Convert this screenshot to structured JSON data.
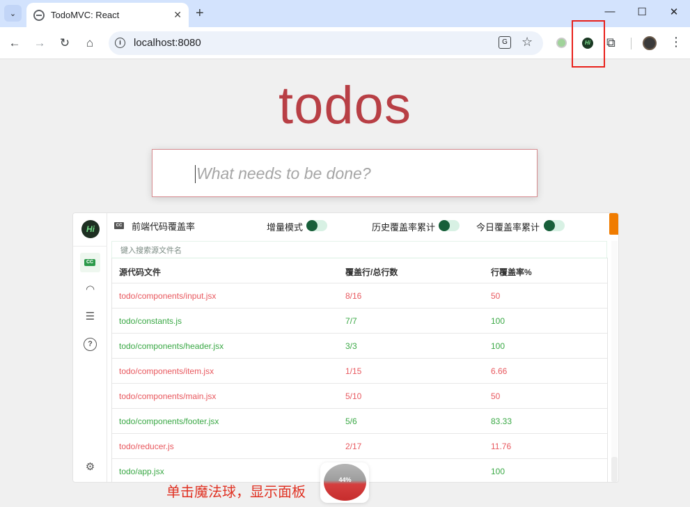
{
  "browser": {
    "tab_title": "TodoMVC: React",
    "url": "localhost:8080",
    "tab_close": "✕",
    "new_tab": "+",
    "minimize": "—",
    "maximize": "☐",
    "close": "✕"
  },
  "app": {
    "title": "todos",
    "input_placeholder": "What needs to be done?"
  },
  "panel": {
    "logo": "Hi",
    "cc_badge": "CC",
    "title": "前端代码覆盖率",
    "toggles": [
      {
        "label": "增量模式",
        "on": true
      },
      {
        "label": "历史覆盖率累计",
        "on": true
      },
      {
        "label": "今日覆盖率累计",
        "on": true
      }
    ],
    "search_placeholder": "键入搜索源文件名",
    "columns": [
      "源代码文件",
      "覆盖行/总行数",
      "行覆盖率%"
    ],
    "rows": [
      {
        "file": "todo/components/input.jsx",
        "lines": "8/16",
        "rate": "50",
        "color": "#e8585e"
      },
      {
        "file": "todo/constants.js",
        "lines": "7/7",
        "rate": "100",
        "color": "#3aa845"
      },
      {
        "file": "todo/components/header.jsx",
        "lines": "3/3",
        "rate": "100",
        "color": "#3aa845"
      },
      {
        "file": "todo/components/item.jsx",
        "lines": "1/15",
        "rate": "6.66",
        "color": "#e8585e"
      },
      {
        "file": "todo/components/main.jsx",
        "lines": "5/10",
        "rate": "50",
        "color": "#e8585e"
      },
      {
        "file": "todo/components/footer.jsx",
        "lines": "5/6",
        "rate": "83.33",
        "color": "#3aa845"
      },
      {
        "file": "todo/reducer.js",
        "lines": "2/17",
        "rate": "11.76",
        "color": "#e8585e"
      },
      {
        "file": "todo/app.jsx",
        "lines": "",
        "rate": "100",
        "color": "#3aa845"
      }
    ]
  },
  "magic_ball": {
    "percent": "44%",
    "caption": "单击魔法球，显示面板"
  },
  "colors": {
    "accent": "#b83f45",
    "upload": "#f07c00",
    "toggle_on": "#185f3a",
    "annotation": "#e03223"
  }
}
